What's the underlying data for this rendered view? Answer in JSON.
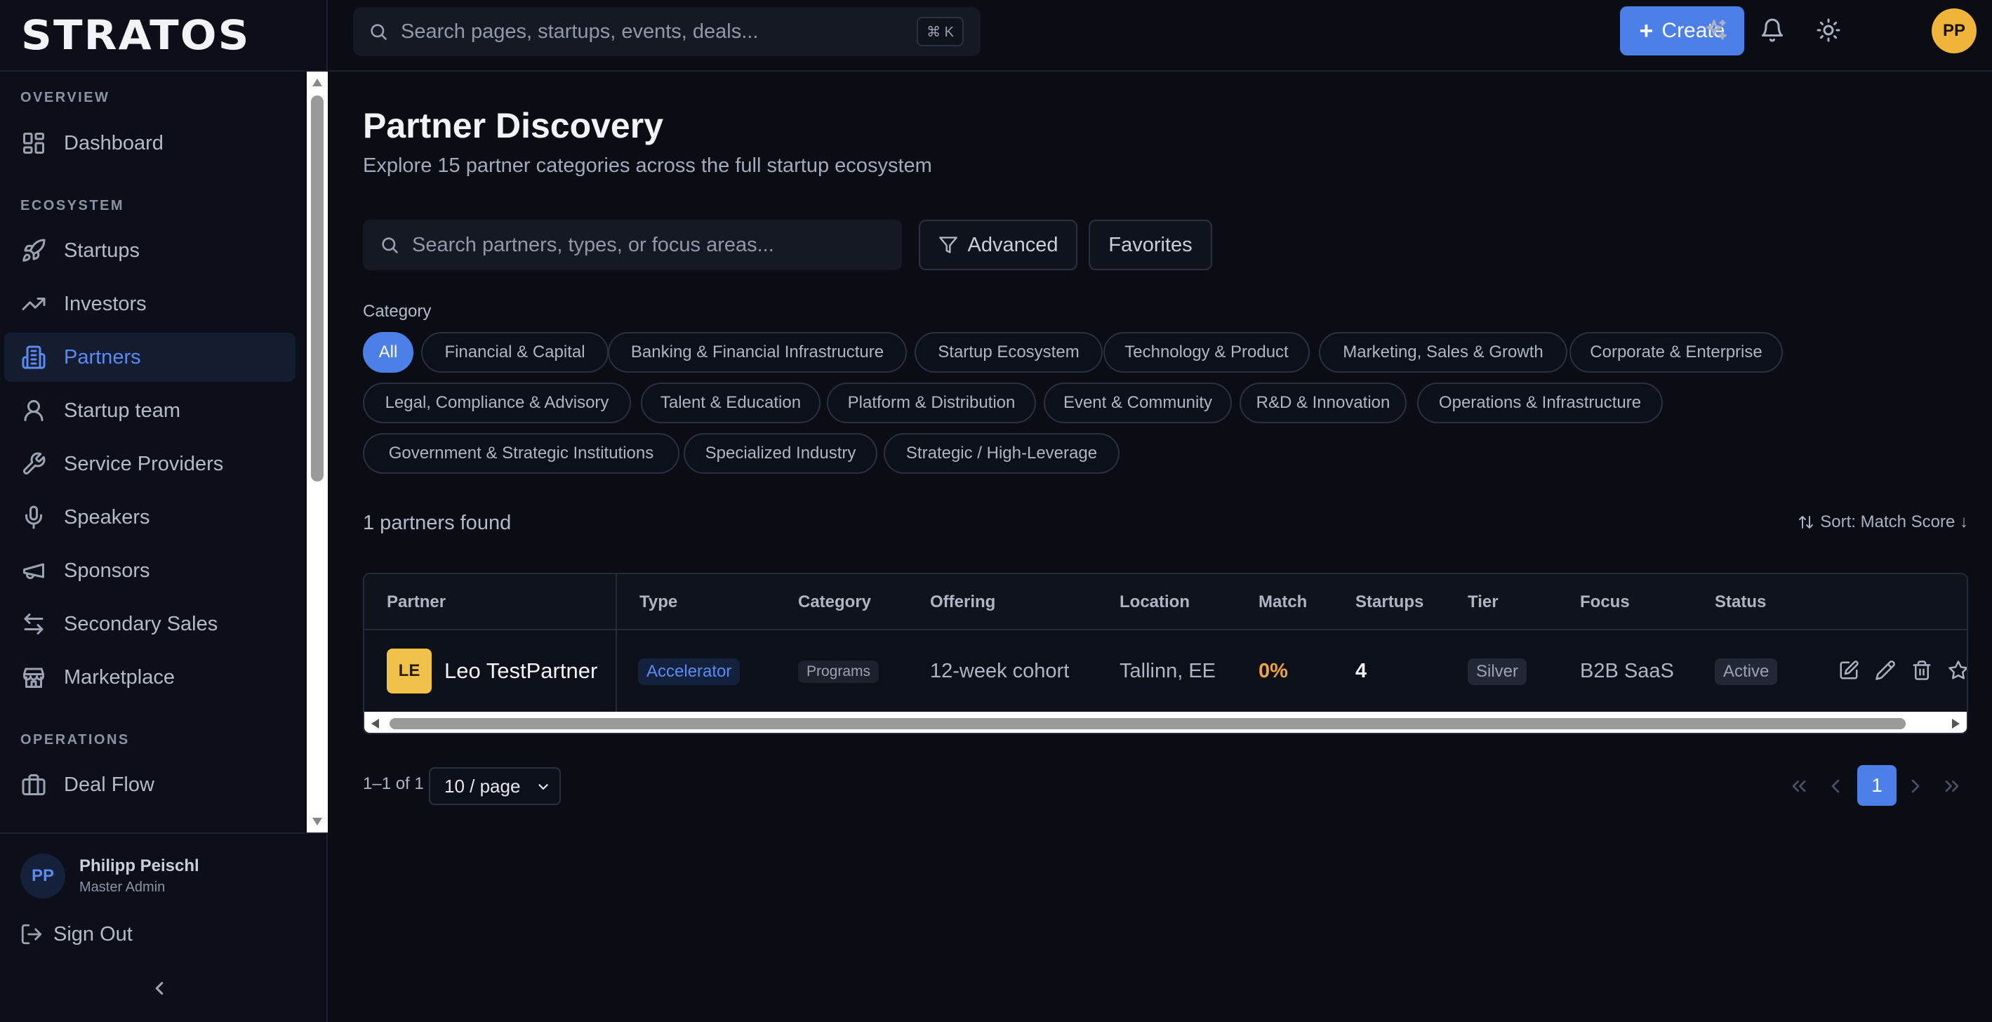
{
  "app": {
    "logo": "STRATOS"
  },
  "sidebar": {
    "sections": [
      {
        "label": "OVERVIEW"
      },
      {
        "label": "ECOSYSTEM"
      },
      {
        "label": "OPERATIONS"
      }
    ],
    "items": [
      {
        "label": "Dashboard",
        "icon": "grid-icon"
      },
      {
        "label": "Startups",
        "icon": "rocket-icon"
      },
      {
        "label": "Investors",
        "icon": "trending-up-icon"
      },
      {
        "label": "Partners",
        "icon": "building-icon",
        "active": true
      },
      {
        "label": "Startup team",
        "icon": "user-icon"
      },
      {
        "label": "Service Providers",
        "icon": "wrench-icon"
      },
      {
        "label": "Speakers",
        "icon": "microphone-icon"
      },
      {
        "label": "Sponsors",
        "icon": "megaphone-icon"
      },
      {
        "label": "Secondary Sales",
        "icon": "arrows-exchange-icon"
      },
      {
        "label": "Marketplace",
        "icon": "store-icon"
      },
      {
        "label": "Deal Flow",
        "icon": "briefcase-icon"
      }
    ],
    "user": {
      "initials": "PP",
      "name": "Philipp Peischl",
      "role": "Master Admin"
    },
    "sign_out": "Sign Out"
  },
  "topbar": {
    "search_placeholder": "Search pages, startups, events, deals...",
    "shortcut": "⌘ K",
    "create_label": "Create",
    "avatar_initials": "PP"
  },
  "page": {
    "title": "Partner Discovery",
    "subtitle": "Explore 15 partner categories across the full startup ecosystem",
    "search_placeholder": "Search partners, types, or focus areas...",
    "advanced_label": "Advanced",
    "favorites_label": "Favorites",
    "category_label": "Category",
    "categories": [
      "All",
      "Financial & Capital",
      "Banking & Financial Infrastructure",
      "Startup Ecosystem",
      "Technology & Product",
      "Marketing, Sales & Growth",
      "Corporate & Enterprise",
      "Legal, Compliance & Advisory",
      "Talent & Education",
      "Platform & Distribution",
      "Event & Community",
      "R&D & Innovation",
      "Operations & Infrastructure",
      "Government & Strategic Institutions",
      "Specialized Industry",
      "Strategic / High-Leverage"
    ],
    "active_category": "All",
    "results_count": "1 partners found",
    "sort_label": "Sort: Match Score ↓"
  },
  "table": {
    "columns": [
      "Partner",
      "Type",
      "Category",
      "Offering",
      "Location",
      "Match",
      "Startups",
      "Tier",
      "Focus",
      "Status"
    ],
    "rows": [
      {
        "initials": "LE",
        "partner": "Leo TestPartner",
        "type": "Accelerator",
        "category": "Programs",
        "offering": "12-week cohort",
        "location": "Tallinn, EE",
        "match": "0%",
        "startups": "4",
        "tier": "Silver",
        "focus": "B2B SaaS",
        "status": "Active"
      }
    ]
  },
  "pagination": {
    "range": "1–1 of 1",
    "page_size": "10 / page",
    "current_page": "1"
  },
  "colors": {
    "accent": "#4c7fe8",
    "background": "#0a0d14",
    "match": "#f0a43a",
    "logo_badge": "#f0c24a",
    "avatar": "#f0b43a"
  }
}
